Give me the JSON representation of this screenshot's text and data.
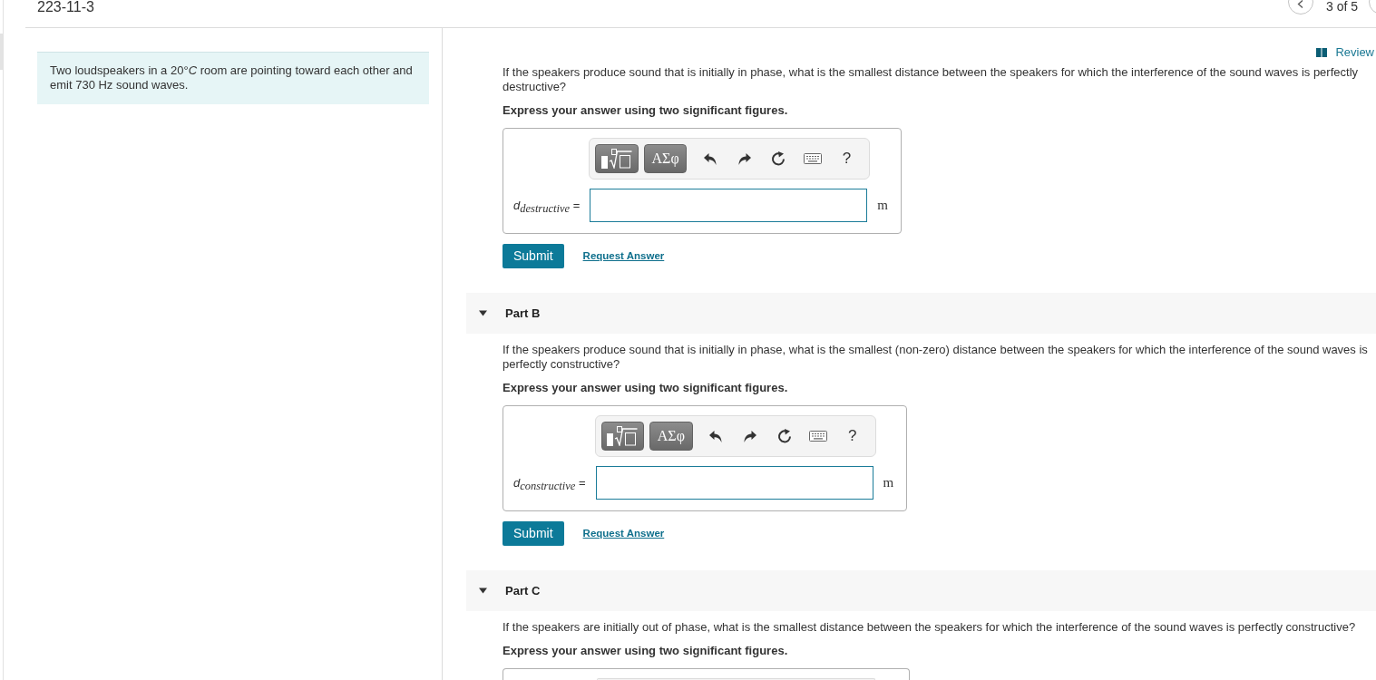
{
  "header": {
    "title": "223-11-3",
    "pager": "3 of 5"
  },
  "problem": {
    "text": "Two loudspeakers in a 20°*C* room are pointing toward each other and emit 730 Hz sound waves."
  },
  "review_link": "Review",
  "parts": [
    {
      "question": "If the speakers produce sound that is initially in phase, what is the smallest distance between the speakers for which the interference of the sound waves is perfectly destructive?",
      "instruction": "Express your answer using two significant figures.",
      "answer": {
        "kind": "full",
        "toolbar": {
          "symbols": "ΑΣφ",
          "help": "?"
        },
        "label": "*d*$_{destructive}$ =",
        "unit": "m"
      },
      "actions": {
        "submit": "Submit",
        "request": "Request Answer"
      }
    },
    {
      "header": {
        "title": "Part B",
        "expanded": true
      },
      "question": "If the speakers produce sound that is initially in phase, what is the smallest (non-zero) distance between the speakers for which the interference of the sound waves is perfectly constructive?",
      "instruction": "Express your answer using two significant figures.",
      "answer": {
        "kind": "full",
        "toolbar": {
          "symbols": "ΑΣφ",
          "help": "?"
        },
        "label": "*d*$_{constructive}$ =",
        "unit": "m"
      },
      "actions": {
        "submit": "Submit",
        "request": "Request Answer"
      }
    },
    {
      "header": {
        "title": "Part C",
        "expanded": true
      },
      "question": "If the speakers are initially out of phase, what is the smallest distance between the speakers for which the interference of the sound waves is perfectly constructive?",
      "instruction": "Express your answer using two significant figures.",
      "answer": {
        "kind": "cut"
      }
    }
  ]
}
